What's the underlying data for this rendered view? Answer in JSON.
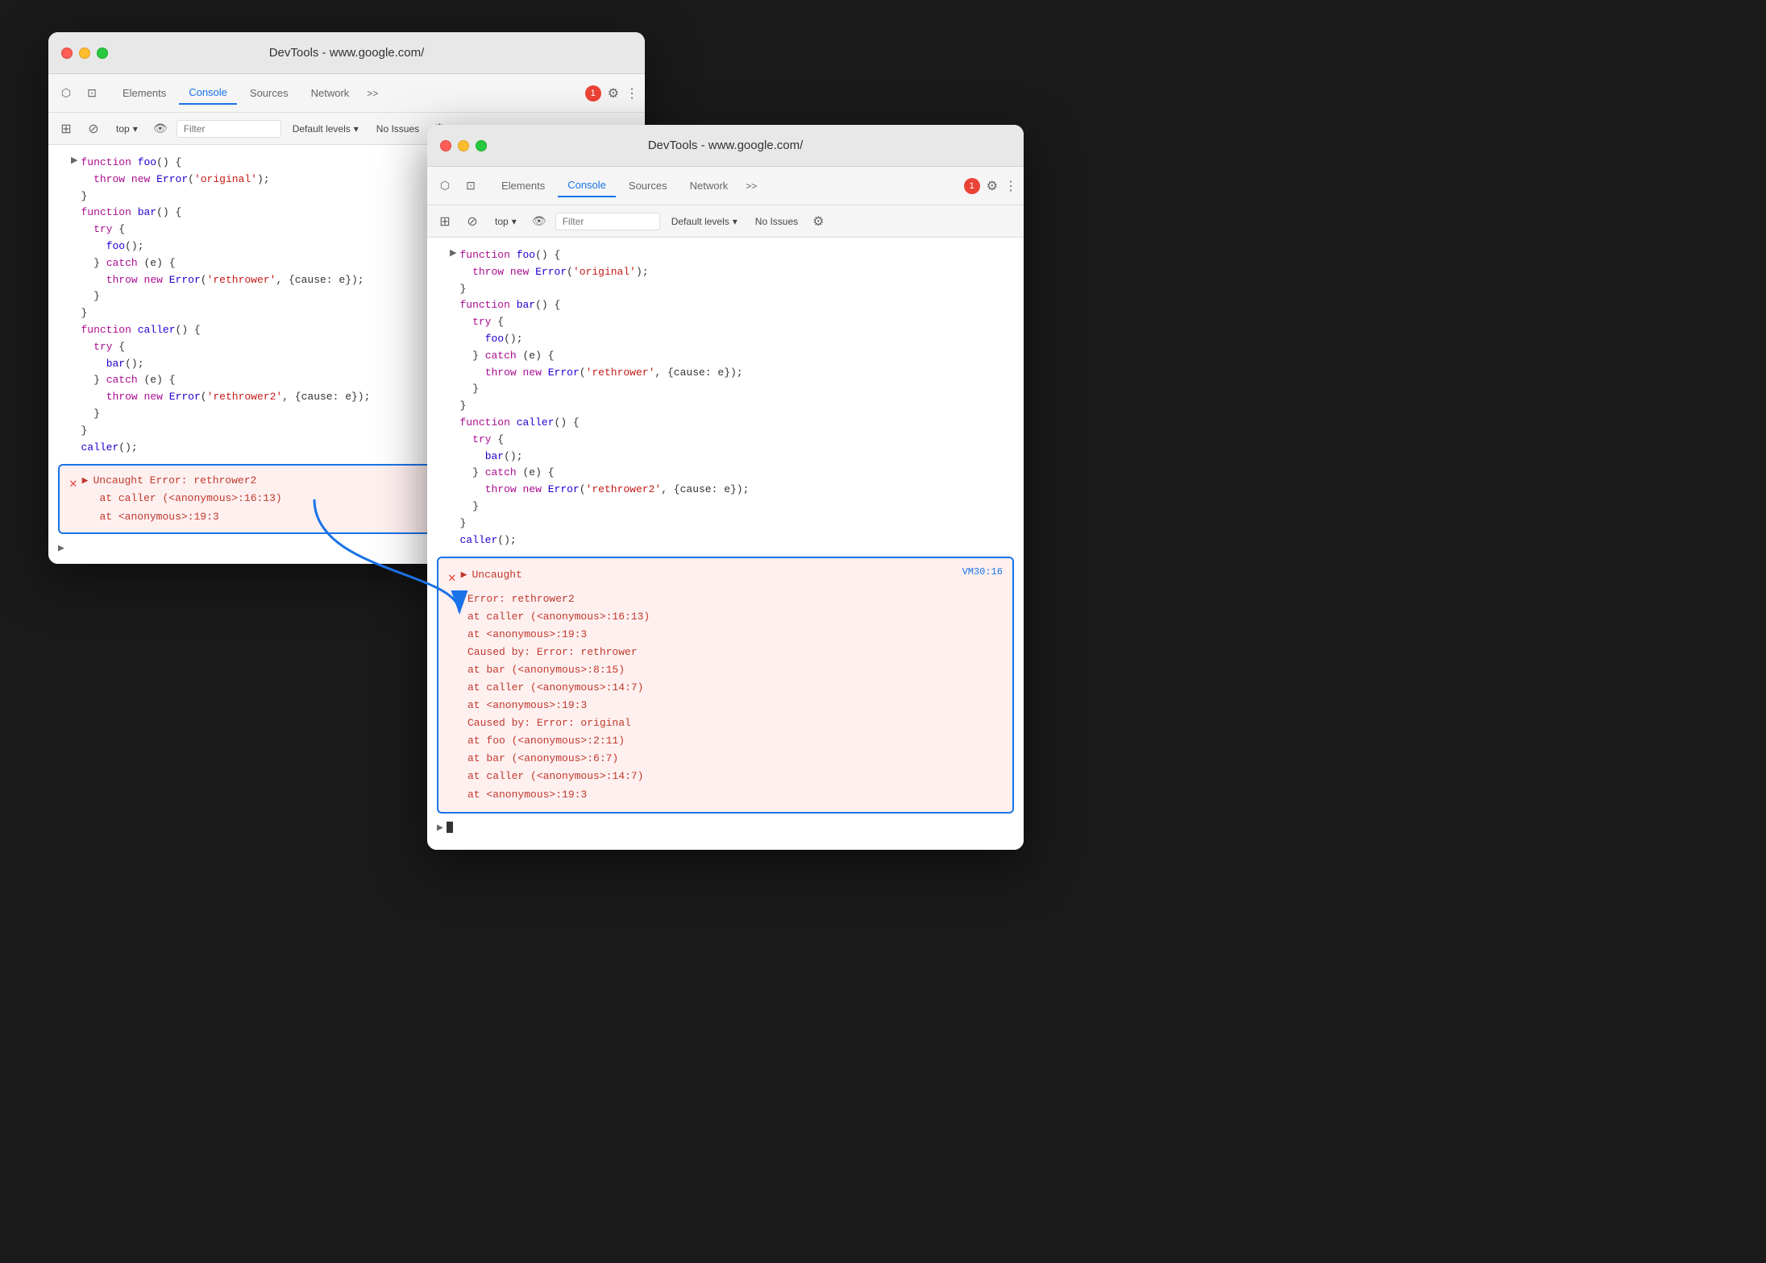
{
  "window": {
    "title": "DevTools - www.google.com/",
    "tabs": [
      {
        "label": "Elements",
        "active": false
      },
      {
        "label": "Console",
        "active": true
      },
      {
        "label": "Sources",
        "active": false
      },
      {
        "label": "Network",
        "active": false
      }
    ],
    "more_tabs": ">>",
    "error_count": "1",
    "top_label": "top",
    "filter_placeholder": "Filter",
    "default_levels": "Default levels",
    "no_issues": "No Issues"
  },
  "code": {
    "line1": "function foo() {",
    "line2": "  throw new Error('original');",
    "line3": "}",
    "line4": "function bar() {",
    "line5": "  try {",
    "line6": "    foo();",
    "line7": "  } catch (e) {",
    "line8": "    throw new Error('rethrower', {cause: e});",
    "line9": "  }",
    "line10": "",
    "line11": "}",
    "line12": "function caller() {",
    "line13": "  try {",
    "line14": "    bar();",
    "line15": "  } catch (e) {",
    "line16": "    throw new Error('rethrower2', {cause: e});",
    "line17": "  }",
    "line18": "}",
    "line19": "caller();"
  },
  "error_back": {
    "icon": "✕",
    "text": "Uncaught Error: rethrower2",
    "line2": "  at caller (<anonymous>:16:13)",
    "line3": "  at <anonymous>:19:3"
  },
  "error_front": {
    "header": "Uncaught",
    "vm_link": "VM30:16",
    "line1": "Error: rethrower2",
    "line2": "    at caller (<anonymous>:16:13)",
    "line3": "    at <anonymous>:19:3",
    "line4": "Caused by: Error: rethrower",
    "line5": "    at bar (<anonymous>:8:15)",
    "line6": "    at caller (<anonymous>:14:7)",
    "line7": "    at <anonymous>:19:3",
    "line8": "Caused by: Error: original",
    "line9": "    at foo (<anonymous>:2:11)",
    "line10": "    at bar (<anonymous>:6:7)",
    "line11": "    at caller (<anonymous>:14:7)",
    "line12": "    at <anonymous>:19:3"
  },
  "icons": {
    "inspect": "⬡",
    "cursor": "↖",
    "prohibit": "⊘",
    "eye": "👁",
    "settings": "⚙",
    "chevron_down": "▾",
    "triangle_right": "▶",
    "triangle_down": "▼",
    "more": "⋮",
    "error_circle": "●"
  }
}
